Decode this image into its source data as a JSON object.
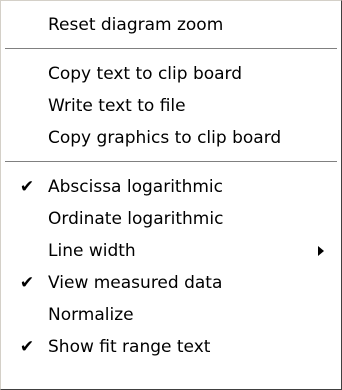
{
  "menu": {
    "groups": [
      {
        "items": [
          {
            "label": "Reset diagram zoom",
            "checked": false,
            "submenu": false
          }
        ]
      },
      {
        "items": [
          {
            "label": "Copy text to clip board",
            "checked": false,
            "submenu": false
          },
          {
            "label": "Write text to file",
            "checked": false,
            "submenu": false
          },
          {
            "label": "Copy graphics to clip board",
            "checked": false,
            "submenu": false
          }
        ]
      },
      {
        "items": [
          {
            "label": "Abscissa logarithmic",
            "checked": true,
            "submenu": false
          },
          {
            "label": "Ordinate logarithmic",
            "checked": false,
            "submenu": false
          },
          {
            "label": "Line width",
            "checked": false,
            "submenu": true
          },
          {
            "label": "View measured data",
            "checked": true,
            "submenu": false
          },
          {
            "label": "Normalize",
            "checked": false,
            "submenu": false
          },
          {
            "label": "Show fit range text",
            "checked": true,
            "submenu": false
          }
        ]
      }
    ],
    "check_glyph": "✔",
    "colors": {
      "background": "#ffffff",
      "text": "#000000",
      "separator": "#808080"
    }
  }
}
